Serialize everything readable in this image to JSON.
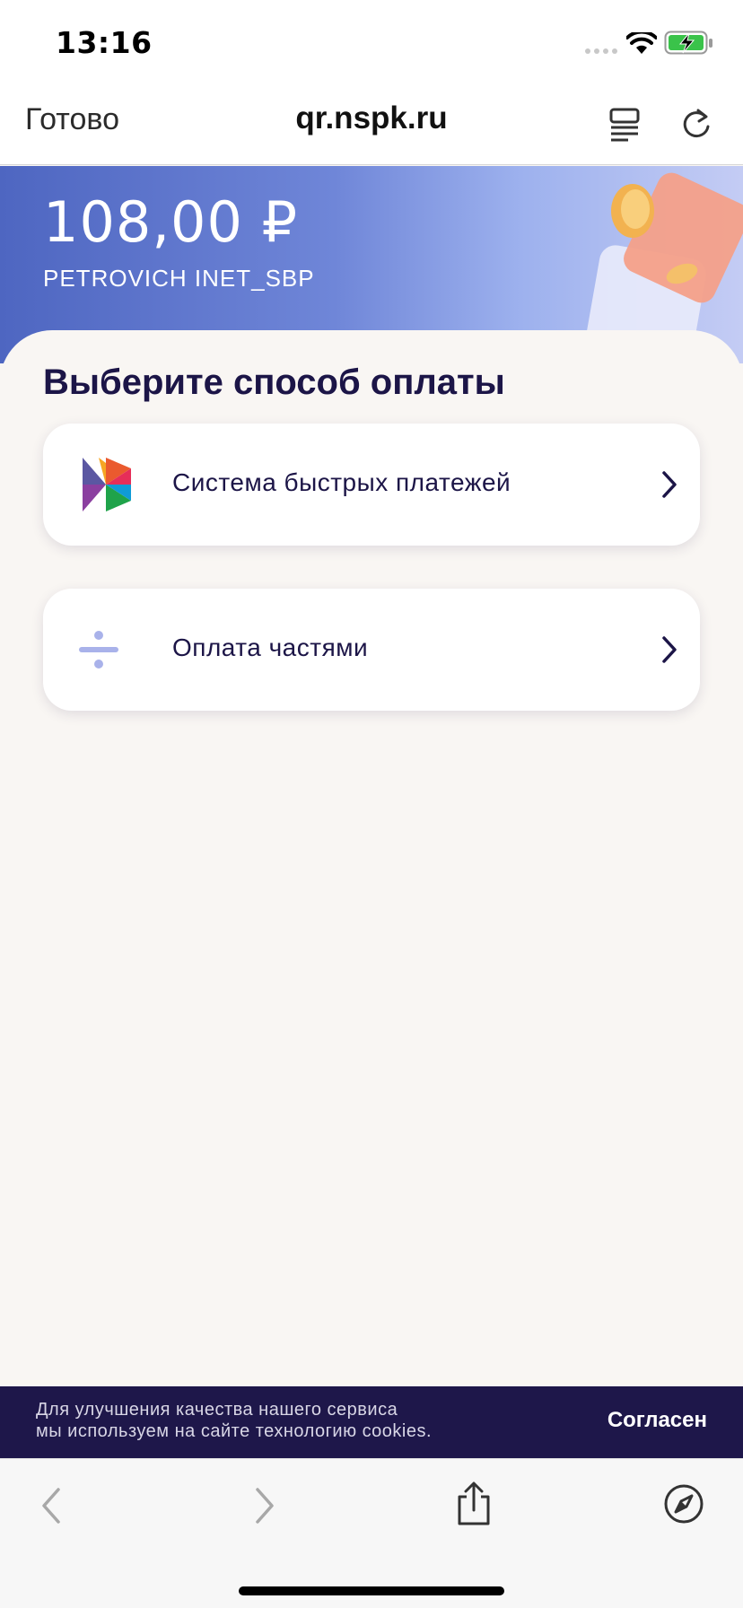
{
  "status_bar": {
    "time": "13:16"
  },
  "nav_bar": {
    "done_label": "Готово",
    "url": "qr.nspk.ru"
  },
  "hero": {
    "amount": "108,00 ₽",
    "merchant": "PETROVICH INET_SBP"
  },
  "main": {
    "title": "Выберите способ оплаты",
    "options": [
      {
        "label": "Система быстрых платежей",
        "icon": "sbp-logo-icon"
      },
      {
        "label": "Оплата частями",
        "icon": "divide-icon"
      }
    ]
  },
  "cookie_banner": {
    "line1": "Для улучшения качества нашего сервиса",
    "line2": "мы используем на сайте технологию cookies.",
    "accept_label": "Согласен"
  },
  "colors": {
    "accent": "#1e174a",
    "hero_start": "#4e66c1",
    "hero_end": "#c4ccf4",
    "background": "#f9f6f3"
  }
}
